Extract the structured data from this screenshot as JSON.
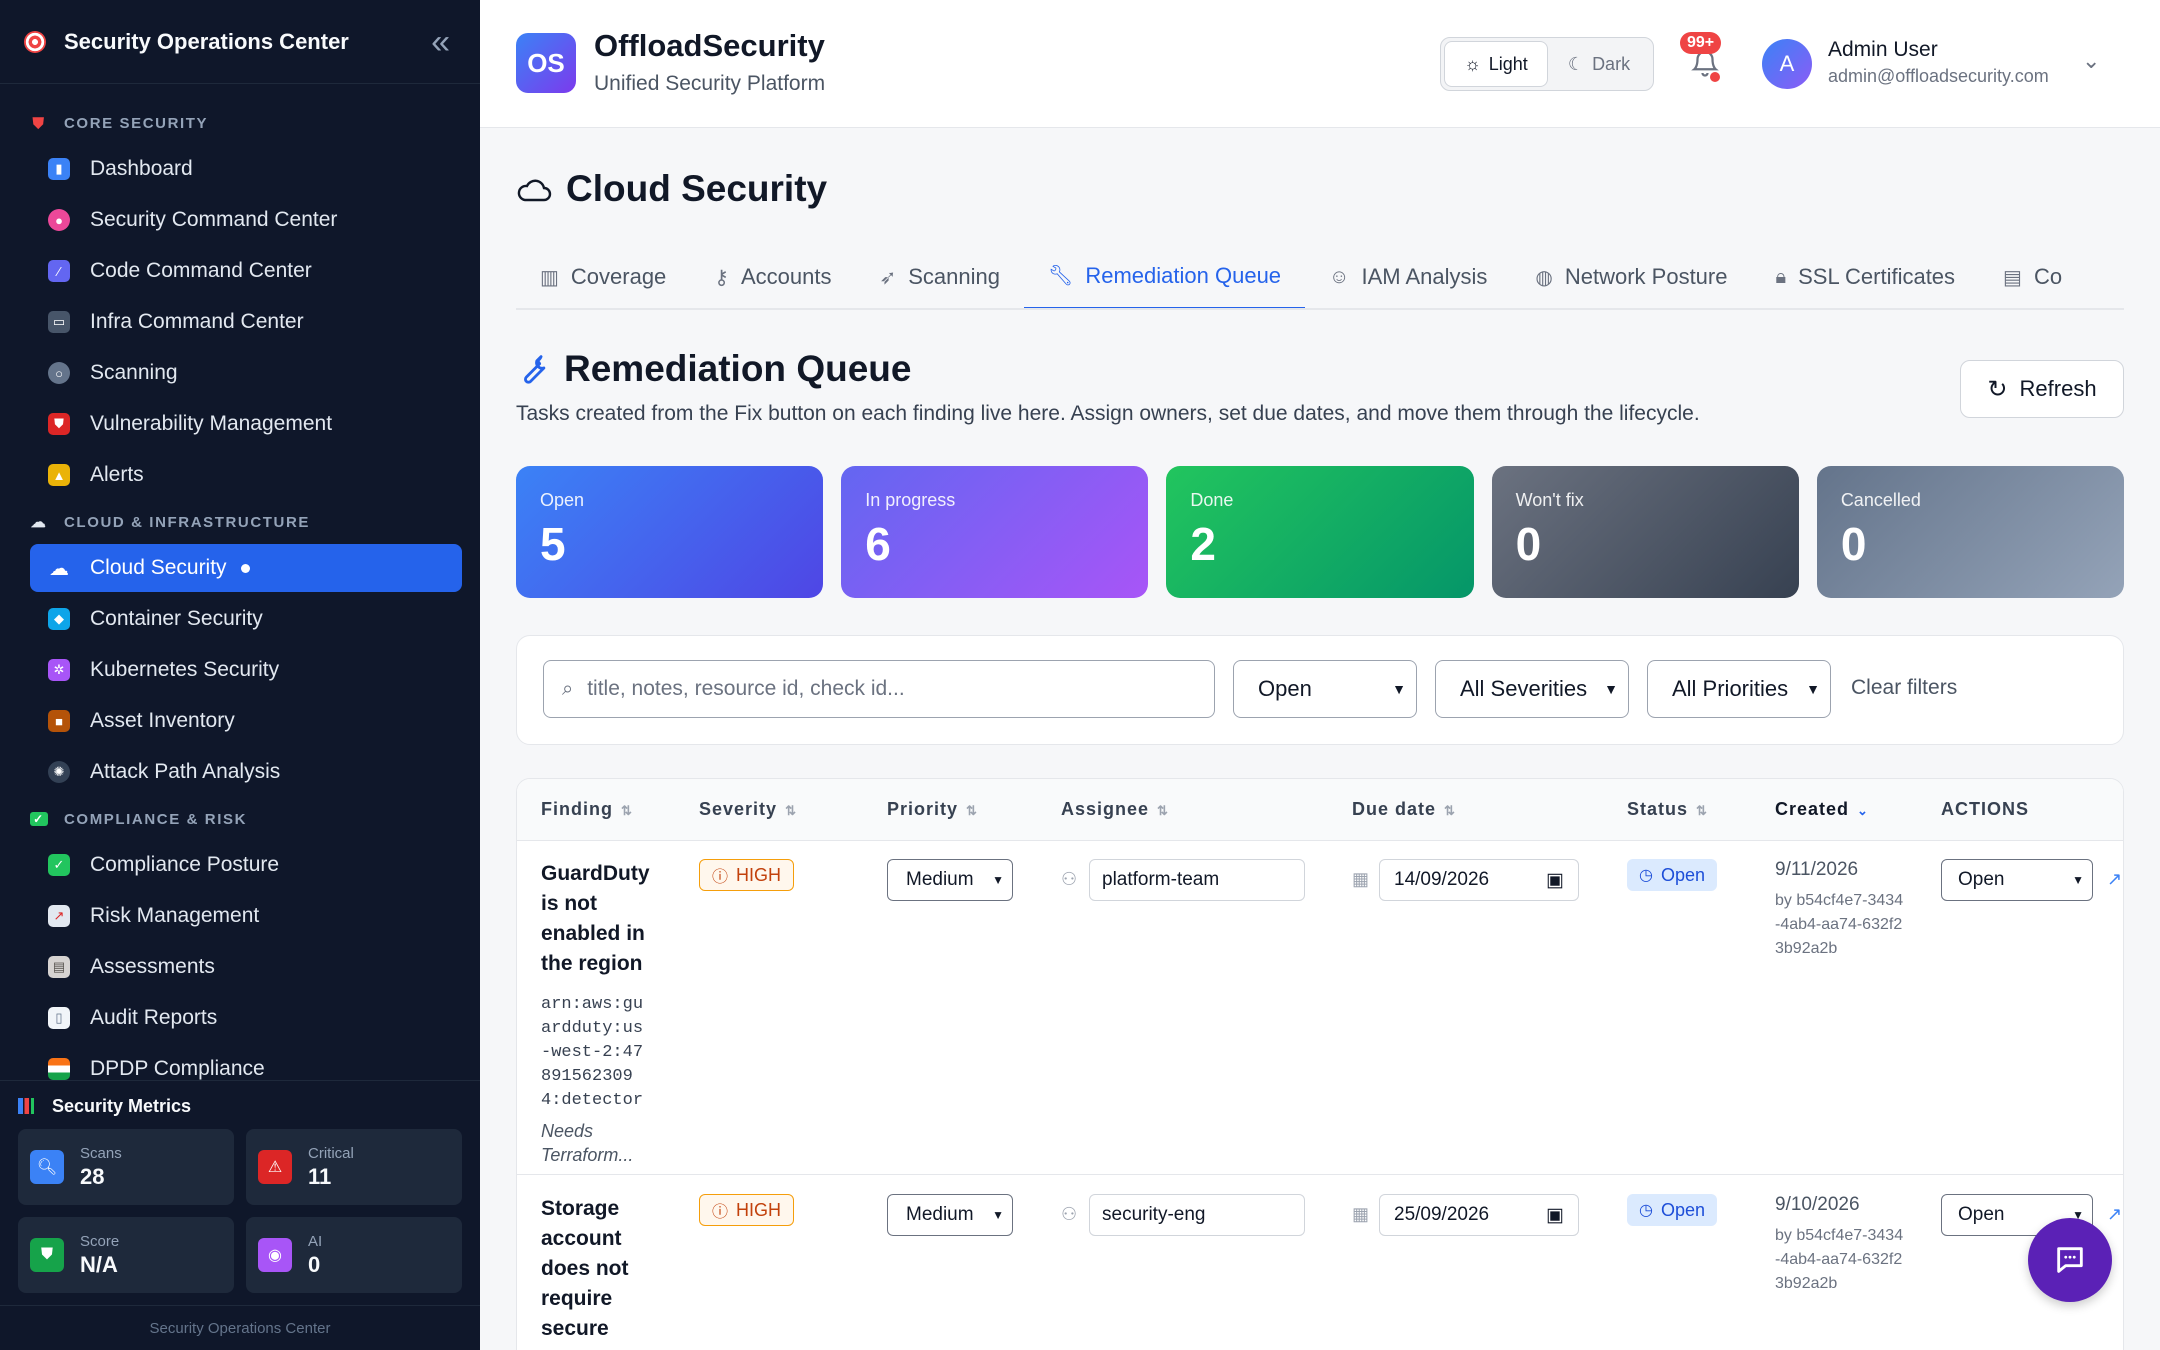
{
  "sidebar": {
    "title": "Security Operations Center",
    "sections": [
      {
        "label": "CORE SECURITY",
        "items": [
          {
            "label": "Dashboard"
          },
          {
            "label": "Security Command Center"
          },
          {
            "label": "Code Command Center"
          },
          {
            "label": "Infra Command Center"
          },
          {
            "label": "Scanning"
          },
          {
            "label": "Vulnerability Management"
          },
          {
            "label": "Alerts"
          }
        ]
      },
      {
        "label": "CLOUD & INFRASTRUCTURE",
        "items": [
          {
            "label": "Cloud Security"
          },
          {
            "label": "Container Security"
          },
          {
            "label": "Kubernetes Security"
          },
          {
            "label": "Asset Inventory"
          },
          {
            "label": "Attack Path Analysis"
          }
        ]
      },
      {
        "label": "COMPLIANCE & RISK",
        "items": [
          {
            "label": "Compliance Posture"
          },
          {
            "label": "Risk Management"
          },
          {
            "label": "Assessments"
          },
          {
            "label": "Audit Reports"
          },
          {
            "label": "DPDP Compliance"
          }
        ]
      }
    ],
    "metrics": {
      "title": "Security Metrics",
      "cards": [
        {
          "label": "Scans",
          "value": "28"
        },
        {
          "label": "Critical",
          "value": "11"
        },
        {
          "label": "Score",
          "value": "N/A"
        },
        {
          "label": "AI",
          "value": "0"
        }
      ]
    },
    "footer": "Security Operations Center"
  },
  "header": {
    "logo_text": "OS",
    "brand": "OffloadSecurity",
    "subtitle": "Unified Security Platform",
    "theme_light": "Light",
    "theme_dark": "Dark",
    "notification_count": "99+",
    "avatar_letter": "A",
    "user_name": "Admin User",
    "user_email": "admin@offloadsecurity.com"
  },
  "page": {
    "title": "Cloud Security",
    "tabs": [
      {
        "label": "Coverage"
      },
      {
        "label": "Accounts"
      },
      {
        "label": "Scanning"
      },
      {
        "label": "Remediation Queue"
      },
      {
        "label": "IAM Analysis"
      },
      {
        "label": "Network Posture"
      },
      {
        "label": "SSL Certificates"
      },
      {
        "label": "Co"
      }
    ]
  },
  "queue": {
    "title": "Remediation Queue",
    "description": "Tasks created from the Fix button on each finding live here. Assign owners, set due dates, and move them through the lifecycle.",
    "refresh_label": "Refresh",
    "stats": [
      {
        "label": "Open",
        "value": "5",
        "color": "#4f46e5"
      },
      {
        "label": "In progress",
        "value": "6",
        "color": "#7c3aed"
      },
      {
        "label": "Done",
        "value": "2",
        "color": "#16a34a"
      },
      {
        "label": "Won't fix",
        "value": "0",
        "color": "#4b5563"
      },
      {
        "label": "Cancelled",
        "value": "0",
        "color": "#6b7280"
      }
    ],
    "filters": {
      "search_placeholder": "title, notes, resource id, check id...",
      "status": "Open",
      "severity": "All Severities",
      "priority": "All Priorities",
      "clear_label": "Clear filters"
    },
    "columns": [
      "Finding",
      "Severity",
      "Priority",
      "Assignee",
      "Due date",
      "Status",
      "Created",
      "ACTIONS"
    ],
    "rows": [
      {
        "title": "GuardDuty is not enabled in the region",
        "resource": "arn:aws:guardduty:us-west-2:478915623094:detector",
        "note": "Needs Terraform...",
        "severity": "HIGH",
        "priority": "Medium",
        "assignee": "platform-team",
        "due": "14/09/2026",
        "status": "Open",
        "created": "9/11/2026",
        "created_by": "by b54cf4e7-3434-4ab4-aa74-632f23b92a2b",
        "action": "Open"
      },
      {
        "title": "Storage account does not require secure",
        "severity": "HIGH",
        "priority": "Medium",
        "assignee": "security-eng",
        "due": "25/09/2026",
        "status": "Open",
        "created": "9/10/2026",
        "created_by": "by b54cf4e7-3434-4ab4-aa74-632f23b92a2b",
        "action": "Open"
      }
    ]
  }
}
